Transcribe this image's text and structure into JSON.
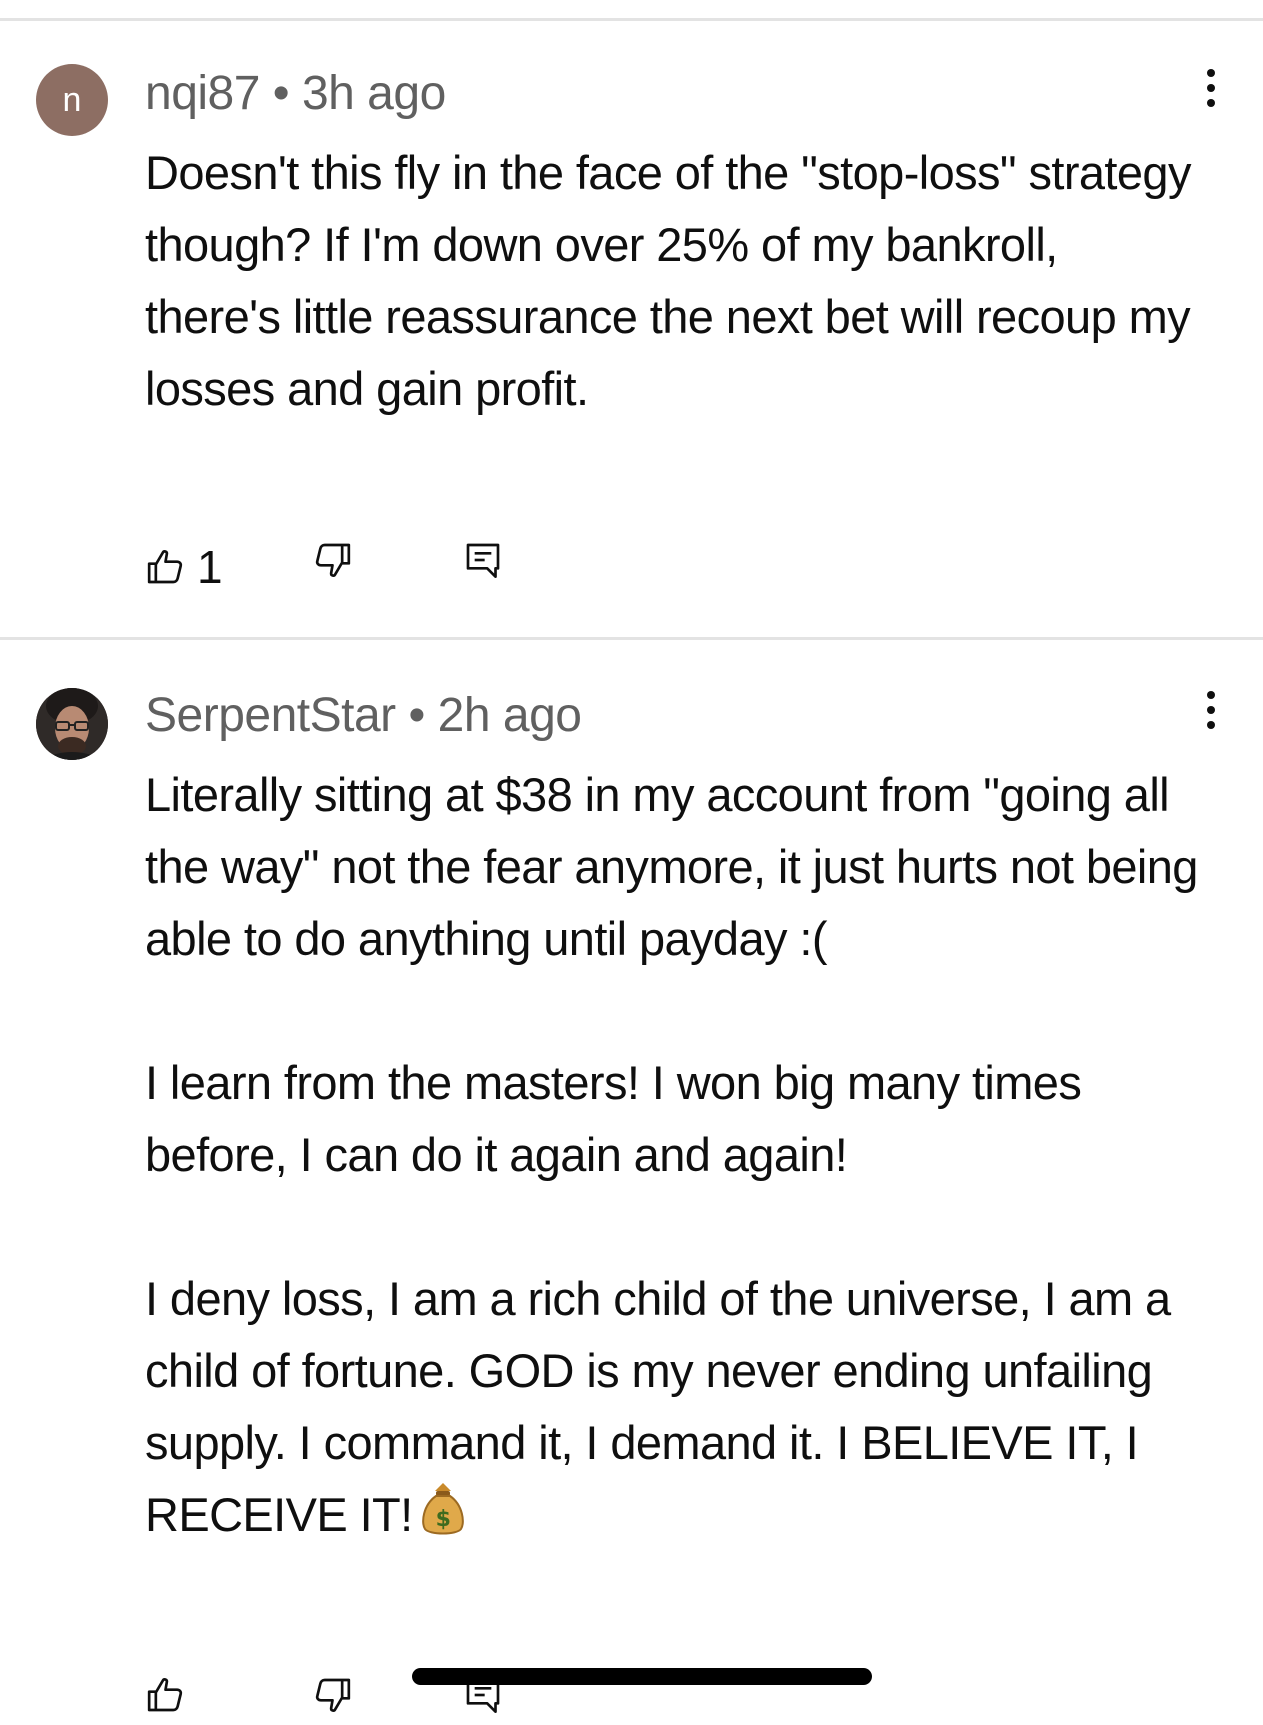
{
  "comments": [
    {
      "author": "nqi87",
      "separator": "•",
      "time": "3h ago",
      "avatar_letter": "n",
      "avatar_color": "#8d6e63",
      "paragraphs": [
        "Doesn't this fly in the face of the \"stop-loss\" strategy though? If I'm down over 25% of my bankroll, there's little reassurance the next bet will recoup my losses and gain profit."
      ],
      "like_count": "1"
    },
    {
      "author": "SerpentStar",
      "separator": "•",
      "time": "2h ago",
      "avatar": "profile-photo",
      "paragraphs": [
        "Literally sitting at $38 in my account from \"going all the way\"  not the fear anymore, it just hurts not being able to do anything until payday :(",
        "I learn from the masters! I won big many times before, I can do it again and again!",
        "I deny loss, I am a rich child of the universe, I am a child of fortune. GOD is my never ending unfailing supply. I command it, I demand it. I BELIEVE IT, I RECEIVE IT!"
      ],
      "trailing_emoji": "money-bag-icon",
      "like_count": ""
    }
  ],
  "icons": {
    "like": "thumbs-up-icon",
    "dislike": "thumbs-down-icon",
    "reply": "reply-icon",
    "more": "more-vertical-icon"
  },
  "colors": {
    "text": "#0f0f0f",
    "meta": "#606060",
    "divider": "#e3e3e3"
  }
}
